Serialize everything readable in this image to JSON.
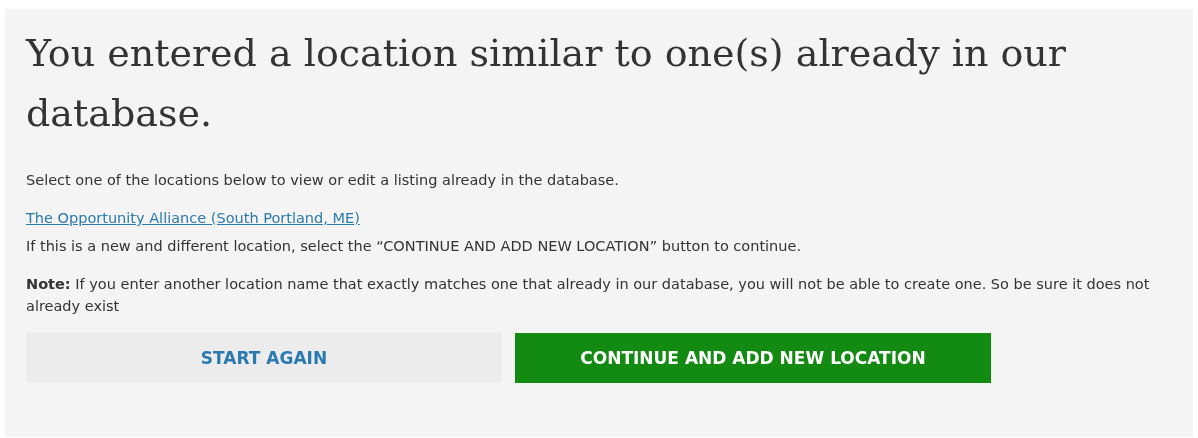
{
  "heading": "You entered a location similar to one(s) already in our database.",
  "instructions": "Select one of the locations below to view or edit a listing already in the database.",
  "matches": [
    {
      "label": "The Opportunity Alliance (South Portland, ME)"
    }
  ],
  "new_location_hint": "If this is a new and different location, select the “CONTINUE AND ADD NEW LOCATION” button to continue.",
  "note": "**Note:** If you enter another location name that exactly matches one that already in our database, you will not be able to create one. So be sure it does not already exist",
  "buttons": [
    {
      "label": "START AGAIN",
      "kind": "secondary"
    },
    {
      "label": "CONTINUE AND ADD NEW LOCATION",
      "kind": "primary"
    }
  ]
}
